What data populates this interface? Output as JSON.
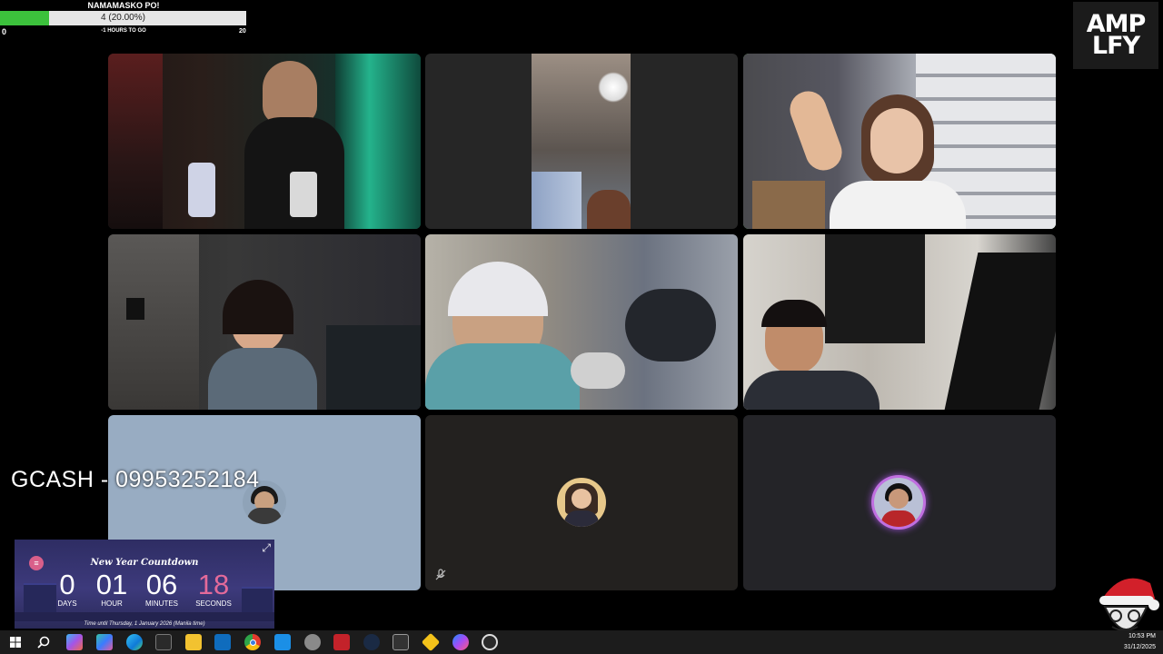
{
  "goal": {
    "title": "NAMAMASKO PO!",
    "progress_label": "4 (20.00%)",
    "progress_fraction": 0.2,
    "min": "0",
    "max": "20",
    "subtitle": "-1 HOURS TO GO"
  },
  "logo": {
    "line1": "AMP",
    "line2": "LFY"
  },
  "gcash": "GCASH - 09953252184",
  "countdown": {
    "title": "New Year Countdown",
    "units": [
      {
        "value": "0",
        "label": "DAYS"
      },
      {
        "value": "01",
        "label": "HOUR"
      },
      {
        "value": "06",
        "label": "MINUTES"
      },
      {
        "value": "18",
        "label": "SECONDS"
      }
    ],
    "footer": "Time until Thursday, 1 January 2026 (Manila time)",
    "badge": "≡",
    "expand_icon": "⤢",
    "colors": {
      "accent": "#e36a9a",
      "background": "#3d3a7c"
    }
  },
  "tiles": [
    {
      "id": "host",
      "kind": "video",
      "active": false
    },
    {
      "id": "tile-2",
      "kind": "video",
      "active": false
    },
    {
      "id": "tile-3",
      "kind": "video",
      "active": true
    },
    {
      "id": "tile-4",
      "kind": "video",
      "active": false
    },
    {
      "id": "tile-5",
      "kind": "video",
      "active": false
    },
    {
      "id": "tile-6",
      "kind": "video",
      "active": false
    },
    {
      "id": "tile-7",
      "kind": "avatar",
      "active": false
    },
    {
      "id": "tile-8",
      "kind": "avatar",
      "active": false,
      "muted": true
    },
    {
      "id": "tile-9",
      "kind": "avatar",
      "active": false,
      "speaking": true
    }
  ],
  "taskbar": {
    "icons": [
      "windows-start",
      "search",
      "copilot",
      "copilot-365",
      "edge",
      "microsoft-store",
      "file-explorer",
      "outlook",
      "chrome",
      "app-blue",
      "app-gray",
      "voicemeeter",
      "steam",
      "app-dots",
      "app-yellow",
      "messenger",
      "obs"
    ],
    "clock_time": "10:53 PM",
    "clock_date": "31/12/2025"
  },
  "window_controls": [
    "–",
    "◻",
    "✕"
  ]
}
